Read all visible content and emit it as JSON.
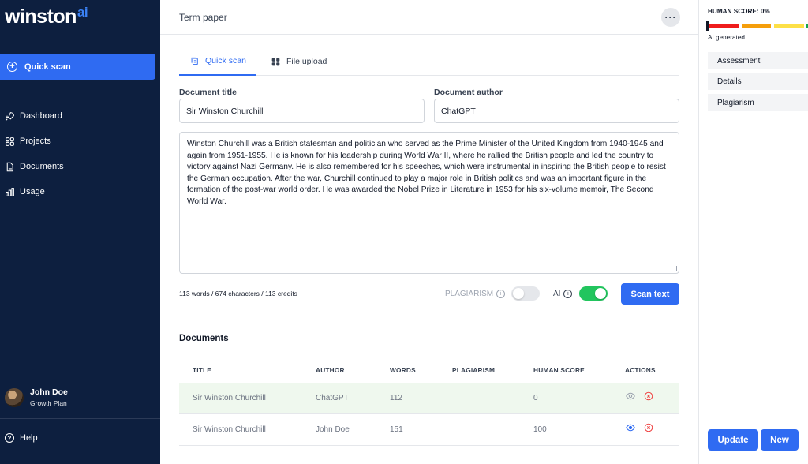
{
  "sidebar": {
    "logo_text": "winston",
    "logo_suffix": "ai",
    "quick_scan_label": "Quick scan",
    "items": [
      {
        "label": "Dashboard",
        "icon": "rocket-icon"
      },
      {
        "label": "Projects",
        "icon": "grid-icon"
      },
      {
        "label": "Documents",
        "icon": "document-icon"
      },
      {
        "label": "Usage",
        "icon": "bar-chart-icon"
      }
    ],
    "user": {
      "name": "John Doe",
      "plan": "Growth Plan"
    },
    "help_label": "Help"
  },
  "header": {
    "title": "Term paper",
    "more_label": "···"
  },
  "tabs": [
    {
      "label": "Quick scan",
      "icon": "copy-icon",
      "active": true
    },
    {
      "label": "File upload",
      "icon": "grid-icon",
      "active": false
    }
  ],
  "form": {
    "title_label": "Document title",
    "title_value": "Sir Winston Churchill",
    "author_label": "Document author",
    "author_value": "ChatGPT",
    "text": "Winston Churchill was a British statesman and politician who served as the Prime Minister of the United Kingdom from 1940-1945 and again from 1951-1955. He is known for his leadership during World War II, where he rallied the British people and led the country to victory against Nazi Germany. He is also remembered for his speeches, which were instrumental in inspiring the British people to resist the German occupation. After the war, Churchill continued to play a major role in British politics and was an important figure in the formation of the post-war world order. He was awarded the Nobel Prize in Literature in 1953 for his six-volume memoir, The Second World War.",
    "counts": "113 words / 674 characters / 113 credits",
    "plagiarism_label": "PLAGIARISM",
    "plagiarism_on": false,
    "ai_label": "AI",
    "ai_on": true,
    "scan_button": "Scan text"
  },
  "documents": {
    "title": "Documents",
    "columns": [
      "TITLE",
      "AUTHOR",
      "WORDS",
      "PLAGIARISM",
      "HUMAN SCORE",
      "ACTIONS"
    ],
    "rows": [
      {
        "title": "Sir Winston Churchill",
        "author": "ChatGPT",
        "words": "112",
        "plagiarism": "",
        "human_score": "0",
        "highlight": true
      },
      {
        "title": "Sir Winston Churchill",
        "author": "John Doe",
        "words": "151",
        "plagiarism": "",
        "human_score": "100",
        "highlight": false
      }
    ]
  },
  "rightpanel": {
    "human_score_label": "HUMAN SCORE: 0%",
    "human_score_value": 0,
    "verdict": "AI generated",
    "items": [
      "Assessment",
      "Details",
      "Plagiarism"
    ],
    "update_button": "Update",
    "new_button": "New"
  },
  "colors": {
    "sidebar_bg": "#0d1f3f",
    "accent": "#2f6bf2",
    "toggle_on": "#22c55e",
    "score_red": "#ef1c1c",
    "score_orange": "#f59e0b",
    "score_yellow": "#fde047",
    "score_green": "#16a34a"
  }
}
